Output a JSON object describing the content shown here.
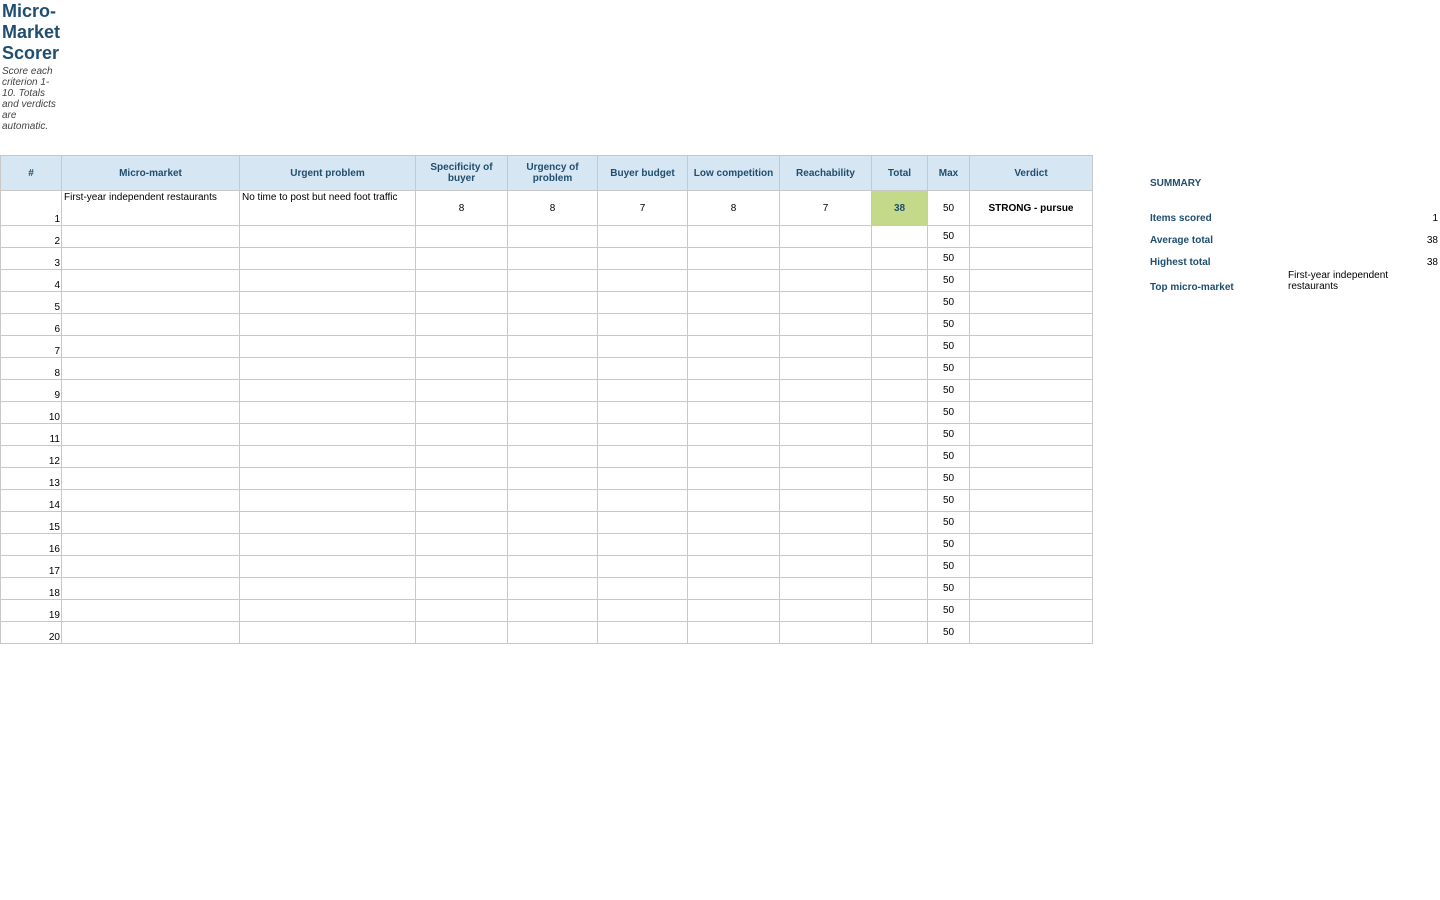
{
  "sheet": {
    "title": "Micro-Market Scorer",
    "subtitle": "Score each criterion 1-10. Totals and verdicts are automatic."
  },
  "table": {
    "headers": [
      "#",
      "Micro-market",
      "Urgent problem",
      "Specificity of buyer",
      "Urgency of problem",
      "Buyer budget",
      "Low competition",
      "Reachability",
      "Total",
      "Max",
      "Verdict"
    ],
    "rows": [
      {
        "num": "1",
        "market": "First-year independent restaurants",
        "problem": "No time to post but need foot traffic",
        "specificity": "8",
        "urgency": "8",
        "budget": "7",
        "competition": "8",
        "reachability": "7",
        "total": "38",
        "max": "50",
        "verdict": "STRONG - pursue"
      },
      {
        "num": "2",
        "market": "",
        "problem": "",
        "specificity": "",
        "urgency": "",
        "budget": "",
        "competition": "",
        "reachability": "",
        "total": "",
        "max": "50",
        "verdict": ""
      },
      {
        "num": "3",
        "market": "",
        "problem": "",
        "specificity": "",
        "urgency": "",
        "budget": "",
        "competition": "",
        "reachability": "",
        "total": "",
        "max": "50",
        "verdict": ""
      },
      {
        "num": "4",
        "market": "",
        "problem": "",
        "specificity": "",
        "urgency": "",
        "budget": "",
        "competition": "",
        "reachability": "",
        "total": "",
        "max": "50",
        "verdict": ""
      },
      {
        "num": "5",
        "market": "",
        "problem": "",
        "specificity": "",
        "urgency": "",
        "budget": "",
        "competition": "",
        "reachability": "",
        "total": "",
        "max": "50",
        "verdict": ""
      },
      {
        "num": "6",
        "market": "",
        "problem": "",
        "specificity": "",
        "urgency": "",
        "budget": "",
        "competition": "",
        "reachability": "",
        "total": "",
        "max": "50",
        "verdict": ""
      },
      {
        "num": "7",
        "market": "",
        "problem": "",
        "specificity": "",
        "urgency": "",
        "budget": "",
        "competition": "",
        "reachability": "",
        "total": "",
        "max": "50",
        "verdict": ""
      },
      {
        "num": "8",
        "market": "",
        "problem": "",
        "specificity": "",
        "urgency": "",
        "budget": "",
        "competition": "",
        "reachability": "",
        "total": "",
        "max": "50",
        "verdict": ""
      },
      {
        "num": "9",
        "market": "",
        "problem": "",
        "specificity": "",
        "urgency": "",
        "budget": "",
        "competition": "",
        "reachability": "",
        "total": "",
        "max": "50",
        "verdict": ""
      },
      {
        "num": "10",
        "market": "",
        "problem": "",
        "specificity": "",
        "urgency": "",
        "budget": "",
        "competition": "",
        "reachability": "",
        "total": "",
        "max": "50",
        "verdict": ""
      },
      {
        "num": "11",
        "market": "",
        "problem": "",
        "specificity": "",
        "urgency": "",
        "budget": "",
        "competition": "",
        "reachability": "",
        "total": "",
        "max": "50",
        "verdict": ""
      },
      {
        "num": "12",
        "market": "",
        "problem": "",
        "specificity": "",
        "urgency": "",
        "budget": "",
        "competition": "",
        "reachability": "",
        "total": "",
        "max": "50",
        "verdict": ""
      },
      {
        "num": "13",
        "market": "",
        "problem": "",
        "specificity": "",
        "urgency": "",
        "budget": "",
        "competition": "",
        "reachability": "",
        "total": "",
        "max": "50",
        "verdict": ""
      },
      {
        "num": "14",
        "market": "",
        "problem": "",
        "specificity": "",
        "urgency": "",
        "budget": "",
        "competition": "",
        "reachability": "",
        "total": "",
        "max": "50",
        "verdict": ""
      },
      {
        "num": "15",
        "market": "",
        "problem": "",
        "specificity": "",
        "urgency": "",
        "budget": "",
        "competition": "",
        "reachability": "",
        "total": "",
        "max": "50",
        "verdict": ""
      },
      {
        "num": "16",
        "market": "",
        "problem": "",
        "specificity": "",
        "urgency": "",
        "budget": "",
        "competition": "",
        "reachability": "",
        "total": "",
        "max": "50",
        "verdict": ""
      },
      {
        "num": "17",
        "market": "",
        "problem": "",
        "specificity": "",
        "urgency": "",
        "budget": "",
        "competition": "",
        "reachability": "",
        "total": "",
        "max": "50",
        "verdict": ""
      },
      {
        "num": "18",
        "market": "",
        "problem": "",
        "specificity": "",
        "urgency": "",
        "budget": "",
        "competition": "",
        "reachability": "",
        "total": "",
        "max": "50",
        "verdict": ""
      },
      {
        "num": "19",
        "market": "",
        "problem": "",
        "specificity": "",
        "urgency": "",
        "budget": "",
        "competition": "",
        "reachability": "",
        "total": "",
        "max": "50",
        "verdict": ""
      },
      {
        "num": "20",
        "market": "",
        "problem": "",
        "specificity": "",
        "urgency": "",
        "budget": "",
        "competition": "",
        "reachability": "",
        "total": "",
        "max": "50",
        "verdict": ""
      }
    ]
  },
  "summary": {
    "title": "SUMMARY",
    "items_scored_label": "Items scored",
    "items_scored_value": "1",
    "average_total_label": "Average total",
    "average_total_value": "38",
    "highest_total_label": "Highest total",
    "highest_total_value": "38",
    "top_market_label": "Top micro-market",
    "top_market_value": "First-year independent restaurants"
  },
  "colors": {
    "header_fill": "#d6e6f2",
    "header_text": "#1f4e6e",
    "total_highlight": "#c4d98a",
    "gridline": "#c8c8c8"
  }
}
